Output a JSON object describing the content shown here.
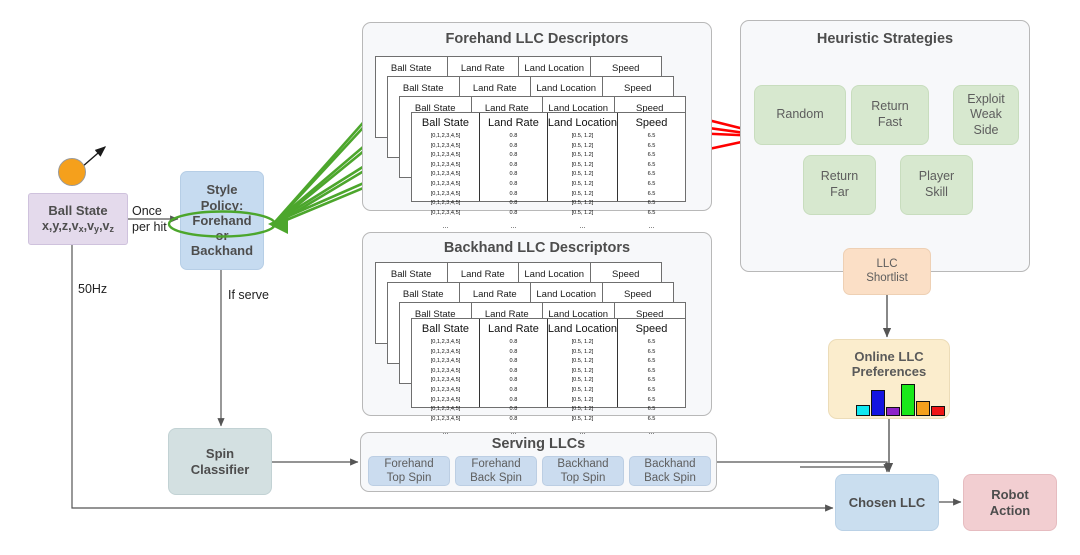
{
  "nodes": {
    "ball_state": {
      "title": "Ball State",
      "vars": "x,y,z,v",
      "vars_full": "x,y,z,vx,vy,vz"
    },
    "style_policy": {
      "line1": "Style",
      "line2": "Policy:",
      "line3": "Forehand",
      "line4": "or",
      "line5": "Backhand"
    },
    "spin_classifier": {
      "line1": "Spin",
      "line2": "Classifier"
    },
    "chosen_llc": {
      "label": "Chosen LLC"
    },
    "robot_action": {
      "line1": "Robot",
      "line2": "Action"
    },
    "llc_shortlist": {
      "line1": "LLC",
      "line2": "Shortlist"
    },
    "online_prefs": {
      "line1": "Online LLC",
      "line2": "Preferences"
    }
  },
  "edge_labels": {
    "once_per_hit_1": "Once",
    "once_per_hit_2": "per hit",
    "fifty_hz": "50Hz",
    "if_serve": "If serve"
  },
  "panels": {
    "forehand": {
      "title": "Forehand LLC Descriptors"
    },
    "backhand": {
      "title": "Backhand LLC Descriptors"
    },
    "heuristics": {
      "title": "Heuristic Strategies"
    },
    "serving": {
      "title": "Serving LLCs"
    }
  },
  "descriptor_table": {
    "columns": [
      "Ball State",
      "Land Rate",
      "Land Location",
      "Speed"
    ],
    "rows": [
      [
        "[0,1,2,3,4,5]",
        "0.8",
        "[0.5, 1.2]",
        "6.5"
      ],
      [
        "[0,1,2,3,4,5]",
        "0.8",
        "[0.5, 1.2]",
        "6.5"
      ],
      [
        "[0,1,2,3,4,5]",
        "0.8",
        "[0.5, 1.2]",
        "6.5"
      ],
      [
        "[0,1,2,3,4,5]",
        "0.8",
        "[0.5, 1.2]",
        "6.5"
      ],
      [
        "[0,1,2,3,4,5]",
        "0.8",
        "[0.5, 1.2]",
        "6.5"
      ],
      [
        "[0,1,2,3,4,5]",
        "0.8",
        "[0.5, 1.2]",
        "6.5"
      ],
      [
        "[0,1,2,3,4,5]",
        "0.8",
        "[0.5, 1.2]",
        "6.5"
      ],
      [
        "[0,1,2,3,4,5]",
        "0.8",
        "[0.5, 1.2]",
        "6.5"
      ],
      [
        "[0,1,2,3,4,5]",
        "0.8",
        "[0.5, 1.2]",
        "6.5"
      ]
    ],
    "ellipsis": "..."
  },
  "heuristic_strategies": [
    {
      "label": "Random"
    },
    {
      "label": "Return\nFast",
      "l1": "Return",
      "l2": "Fast"
    },
    {
      "label": "Exploit Weak Side",
      "l1": "Exploit",
      "l2": "Weak",
      "l3": "Side"
    },
    {
      "label": "Return Far",
      "l1": "Return",
      "l2": "Far"
    },
    {
      "label": "Player Skill",
      "l1": "Player",
      "l2": "Skill"
    }
  ],
  "serving_llcs": [
    {
      "l1": "Forehand",
      "l2": "Top Spin"
    },
    {
      "l1": "Forehand",
      "l2": "Back Spin"
    },
    {
      "l1": "Backhand",
      "l2": "Top Spin"
    },
    {
      "l1": "Backhand",
      "l2": "Back Spin"
    }
  ],
  "preference_bars": {
    "values": [
      22,
      58,
      18,
      74,
      33,
      20
    ],
    "colors": [
      "#12e8f0",
      "#1414e0",
      "#8e23c8",
      "#1ae81a",
      "#f5a01c",
      "#ef1515"
    ]
  },
  "colors": {
    "ball_state_bg": "#e4daec",
    "style_policy_bg": "#c6dbf0",
    "spin_classifier_bg": "#d3e0e1",
    "chosen_llc_bg": "#cadeef",
    "robot_action_bg": "#f2ced1",
    "online_prefs_bg": "#fbedcd",
    "llc_shortlist_bg": "#fbdfc6",
    "heuristic_bg": "#d7e8cf",
    "serving_chip_bg": "#cbdcef",
    "highlight_green": "#4ca62c",
    "highlight_red": "#ff0000",
    "ball_icon": "#f5a01c"
  },
  "icons": {
    "ball": "ball-icon",
    "velocity_arrow": "velocity-arrow-icon",
    "bar_chart": "bar-chart-icon"
  }
}
